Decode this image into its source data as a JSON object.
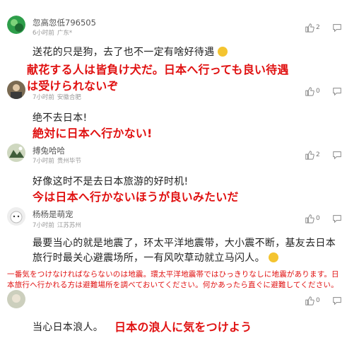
{
  "comments": [
    {
      "username": "忽高忽低796505",
      "time": "6小时前",
      "location": "广东*",
      "likes": "2",
      "text": "送花的只是狗，去了也不一定有啥好待遇",
      "translation": "献花する人は皆負け犬だ。日本へ行っても良い待遇は受けられないぞ",
      "translation_line1": "献花する人は皆負け犬だ。日本へ行っても良い待遇",
      "translation_line2": "は受けられないぞ"
    },
    {
      "username": "",
      "time": "7小时前",
      "location": "安徽合肥",
      "likes": "0",
      "text": "绝不去日本!",
      "translation": "絶対に日本へ行かない!"
    },
    {
      "username": "搏兔哈哈",
      "time": "7小时前",
      "location": "贵州毕节",
      "likes": "2",
      "text": "好像这时不是去日本旅游的好时机!",
      "translation": "今は日本へ行かないほうが良いみたいだ"
    },
    {
      "username": "杨杨是萌宠",
      "time": "7小时前",
      "location": "江苏苏州",
      "likes": "0",
      "text": "最要当心的就是地震了，环太平洋地震带，大小震不断，基友去日本旅行时最关心避震场所，一有风吹草动就立马闪人。",
      "translation": "一番気をつけなければならないのは地震。環太平洋地震帯ではひっきりなしに地震があります。日本旅行へ行かれる方は避難場所を調べておいてください。何かあったら直ぐに避難してください。"
    },
    {
      "username": "",
      "time": "",
      "location": "",
      "likes": "0",
      "text": "当心日本浪人。",
      "translation": "日本の浪人に気をつけよう"
    }
  ],
  "colors": {
    "translation": "#e01010",
    "avatar1": "#2e9e4a"
  },
  "icons": {
    "like": "thumbs-up-icon",
    "reply": "reply-icon",
    "emoji": "grin-emoji-icon"
  }
}
